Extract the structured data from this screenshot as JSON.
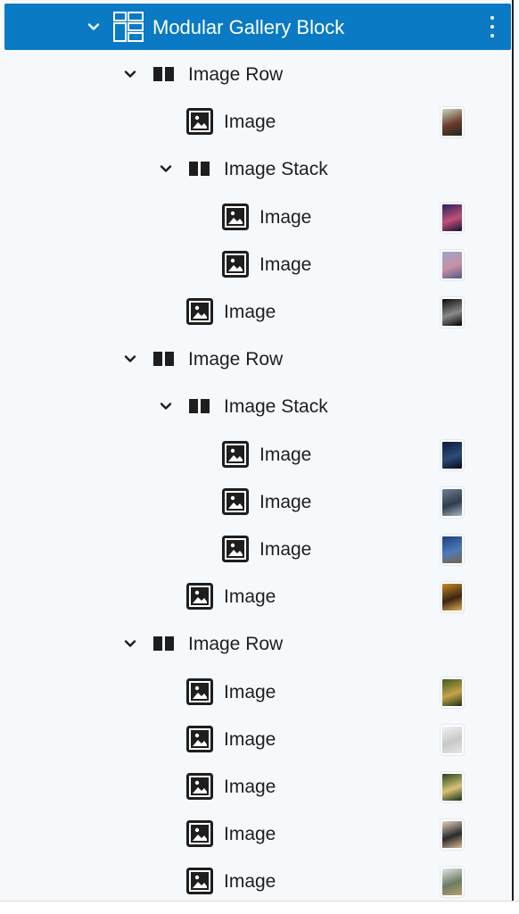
{
  "header": {
    "title": "Modular Gallery Block",
    "accent": "#0a7ac4"
  },
  "rows": [
    {
      "label": "Image Row",
      "type": "row",
      "indent": 0
    },
    {
      "label": "Image",
      "type": "image",
      "indent": 1,
      "thumb": [
        "#c9d6c2",
        "#6b3b2a",
        "#1e2a23"
      ]
    },
    {
      "label": "Image Stack",
      "type": "stack",
      "indent": 1
    },
    {
      "label": "Image",
      "type": "image",
      "indent": 2,
      "thumb": [
        "#2a1f5e",
        "#c0507a",
        "#141432"
      ]
    },
    {
      "label": "Image",
      "type": "image",
      "indent": 2,
      "thumb": [
        "#9aa7c9",
        "#c98fa7",
        "#4e5c84"
      ]
    },
    {
      "label": "Image",
      "type": "image",
      "indent": 1,
      "thumb": [
        "#0a0a0a",
        "#8a8a8a",
        "#000000"
      ]
    },
    {
      "label": "Image Row",
      "type": "row",
      "indent": 0
    },
    {
      "label": "Image Stack",
      "type": "stack",
      "indent": 1
    },
    {
      "label": "Image",
      "type": "image",
      "indent": 2,
      "thumb": [
        "#0c1a3a",
        "#2b4d7a",
        "#070b18"
      ]
    },
    {
      "label": "Image",
      "type": "image",
      "indent": 2,
      "thumb": [
        "#6f7f92",
        "#2f3c4c",
        "#a6b2bf"
      ]
    },
    {
      "label": "Image",
      "type": "image",
      "indent": 2,
      "thumb": [
        "#1b3f7a",
        "#4f7ab8",
        "#7c6246"
      ]
    },
    {
      "label": "Image",
      "type": "image",
      "indent": 1,
      "thumb": [
        "#c98a22",
        "#3c2414",
        "#e0b050"
      ]
    },
    {
      "label": "Image Row",
      "type": "row",
      "indent": 0
    },
    {
      "label": "Image",
      "type": "image",
      "indent": 1,
      "thumb": [
        "#3d5d1e",
        "#c7a24c",
        "#1f3314"
      ]
    },
    {
      "label": "Image",
      "type": "image",
      "indent": 1,
      "thumb": [
        "#f2f2f2",
        "#c8c8c8",
        "#e6e6e6"
      ]
    },
    {
      "label": "Image",
      "type": "image",
      "indent": 1,
      "thumb": [
        "#28421b",
        "#d9c27a",
        "#143012"
      ]
    },
    {
      "label": "Image",
      "type": "image",
      "indent": 1,
      "thumb": [
        "#e3d3bc",
        "#2a2a2a",
        "#d8b898"
      ]
    },
    {
      "label": "Image",
      "type": "image",
      "indent": 1,
      "thumb": [
        "#dfe6e6",
        "#6c7c60",
        "#b8a070"
      ]
    }
  ]
}
